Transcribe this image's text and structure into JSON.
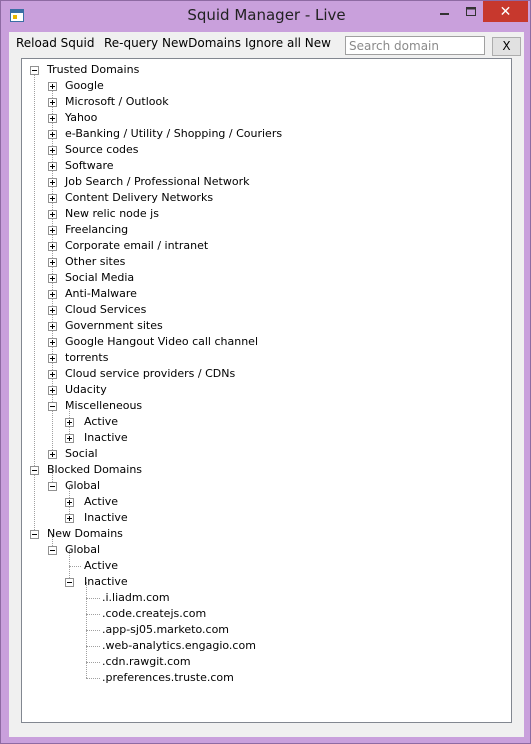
{
  "window": {
    "title": "Squid Manager - Live"
  },
  "menu": {
    "reload": "Reload Squid",
    "requery": "Re-query NewDomains",
    "ignore": "Ignore all New"
  },
  "search": {
    "placeholder": "Search domain"
  },
  "clear_button": "X",
  "titlebar": {
    "close": "✕"
  },
  "tree": {
    "trusted": {
      "label": "Trusted Domains",
      "children": [
        "Google",
        "Microsoft / Outlook",
        "Yahoo",
        "e-Banking / Utility / Shopping / Couriers",
        "Source codes",
        "Software",
        "Job Search / Professional Network",
        "Content Delivery Networks",
        "New relic node js",
        "Freelancing",
        "Corporate email / intranet",
        "Other sites",
        "Social Media",
        "Anti-Malware",
        "Cloud Services",
        "Government sites",
        "Google Hangout Video call channel",
        "torrents",
        "Cloud service providers / CDNs",
        "Udacity"
      ],
      "misc": {
        "label": "Miscelleneous",
        "active": "Active",
        "inactive": "Inactive"
      },
      "social": "Social"
    },
    "blocked": {
      "label": "Blocked Domains",
      "global": {
        "label": "Global",
        "active": "Active",
        "inactive": "Inactive"
      }
    },
    "new": {
      "label": "New Domains",
      "global": {
        "label": "Global",
        "active": "Active",
        "inactive": "Inactive",
        "domains": [
          ".i.liadm.com",
          ".code.createjs.com",
          ".app-sj05.marketo.com",
          ".web-analytics.engagio.com",
          ".cdn.rawgit.com",
          ".preferences.truste.com"
        ]
      }
    }
  }
}
